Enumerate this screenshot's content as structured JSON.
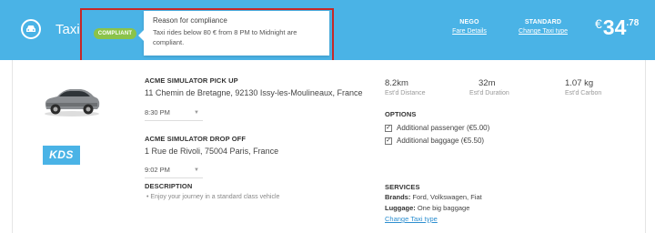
{
  "header": {
    "title": "Taxi",
    "badge": "COMPLIANT",
    "tooltip": {
      "title": "Reason for compliance",
      "text": "Taxi rides below 80 € from 8 PM to Midnight are compliant."
    },
    "nego": {
      "label": "NEGO",
      "link": "Fare Details"
    },
    "standard": {
      "label": "STANDARD",
      "link": "Change Taxi type"
    },
    "price": {
      "currency": "€",
      "whole": "34",
      "cents": ".78"
    },
    "colors": {
      "bar": "#4ab3e6",
      "badge": "#8bc34a",
      "highlight": "#c62828"
    }
  },
  "vehicle": {
    "brand_logo": "KDS",
    "image": "car-icon"
  },
  "pickup": {
    "label": "ACME SIMULATOR PICK UP",
    "address": "11 Chemin de Bretagne, 92130 Issy-les-Moulineaux, France",
    "time": "8:30 PM"
  },
  "dropoff": {
    "label": "ACME SIMULATOR DROP OFF",
    "address": "1 Rue de Rivoli, 75004 Paris, France",
    "time": "9:02 PM"
  },
  "description": {
    "label": "DESCRIPTION",
    "text": "•  Enjoy your journey in a standard class vehicle"
  },
  "stats": {
    "distance": {
      "value": "8.2km",
      "label": "Est'd Distance"
    },
    "duration": {
      "value": "32m",
      "label": "Est'd Duration"
    },
    "carbon": {
      "value": "1.07 kg",
      "label": "Est'd Carbon"
    }
  },
  "options": {
    "label": "OPTIONS",
    "items": [
      {
        "label": "Additional passenger (€5.00)",
        "checked": true
      },
      {
        "label": "Additional baggage (€5.50)",
        "checked": true
      }
    ]
  },
  "services": {
    "label": "SERVICES",
    "brands_key": "Brands:",
    "brands_val": " Ford, Volkswagen, Fiat",
    "luggage_key": "Luggage:",
    "luggage_val": " One big baggage",
    "change_link": "Change Taxi type"
  }
}
